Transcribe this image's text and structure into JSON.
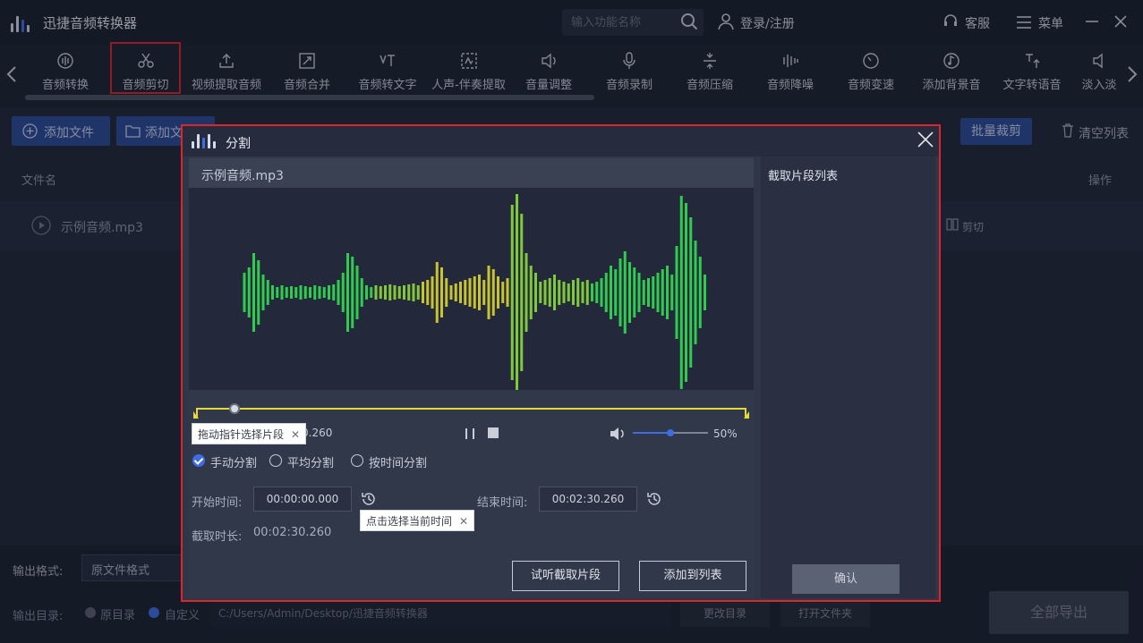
{
  "app": {
    "title": "迅捷音频转换器",
    "search_placeholder": "输入功能名称",
    "login": "登录/注册",
    "support": "客服",
    "menu": "菜单"
  },
  "toolbar": {
    "tools": [
      {
        "label": "音频转换",
        "icon": "waveform-icon"
      },
      {
        "label": "音频剪切",
        "icon": "scissors-icon",
        "active": true
      },
      {
        "label": "视频提取音频",
        "icon": "upload-icon"
      },
      {
        "label": "音频合并",
        "icon": "merge-icon"
      },
      {
        "label": "音频转文字",
        "icon": "speech-to-text-icon"
      },
      {
        "label": "人声-伴奏提取",
        "icon": "vocal-extract-icon"
      },
      {
        "label": "音量调整",
        "icon": "speaker-icon"
      },
      {
        "label": "音频录制",
        "icon": "microphone-icon"
      },
      {
        "label": "音频压缩",
        "icon": "compress-icon"
      },
      {
        "label": "音频降噪",
        "icon": "denoise-icon"
      },
      {
        "label": "音频变速",
        "icon": "speed-icon"
      },
      {
        "label": "添加背景音",
        "icon": "music-note-icon"
      },
      {
        "label": "文字转语音",
        "icon": "text-to-speech-icon"
      },
      {
        "label": "淡入淡",
        "icon": "fade-icon"
      }
    ]
  },
  "main": {
    "add_file": "添加文件",
    "add_folder": "添加文",
    "batch_cut": "批量裁剪",
    "clear_list": "清空列表",
    "col_filename": "文件名",
    "col_operation": "操作",
    "row": {
      "name": "示例音频.mp3",
      "action": "剪切"
    }
  },
  "bottom": {
    "output_format_label": "输出格式:",
    "output_format_value": "原文件格式",
    "output_dir_label": "输出目录:",
    "radio_original": "原目录",
    "radio_custom": "自定义",
    "path": "C:/Users/Admin/Desktop/迅捷音频转换器",
    "change_dir": "更改目录",
    "open_folder": "打开文件夹",
    "export_all": "全部导出"
  },
  "dialog": {
    "title": "分割",
    "filename": "示例音频.mp3",
    "segment_list_title": "截取片段列表",
    "tooltip_drag": "拖动指针选择片段",
    "time_readout": "0.260",
    "volume_level": 0.5,
    "volume_text": "50%",
    "playhead_fraction": 0.07,
    "modes": [
      {
        "label": "手动分割",
        "selected": true
      },
      {
        "label": "平均分割",
        "selected": false
      },
      {
        "label": "按时间分割",
        "selected": false
      }
    ],
    "start_label": "开始时间:",
    "start_value": "00:00:00.000",
    "end_label": "结束时间:",
    "end_value": "00:02:30.260",
    "tooltip_clock": "点击选择当前时间",
    "duration_label": "截取时长:",
    "duration_value": "00:02:30.260",
    "preview_btn": "试听截取片段",
    "add_to_list_btn": "添加到列表",
    "confirm_btn": "确认"
  },
  "colors": {
    "accent_blue": "#3e6de3",
    "highlight_red": "#e1242b",
    "timeline_yellow": "#e6d83a",
    "wave_green": "#2fcc4f",
    "wave_yellow": "#c8c431"
  }
}
